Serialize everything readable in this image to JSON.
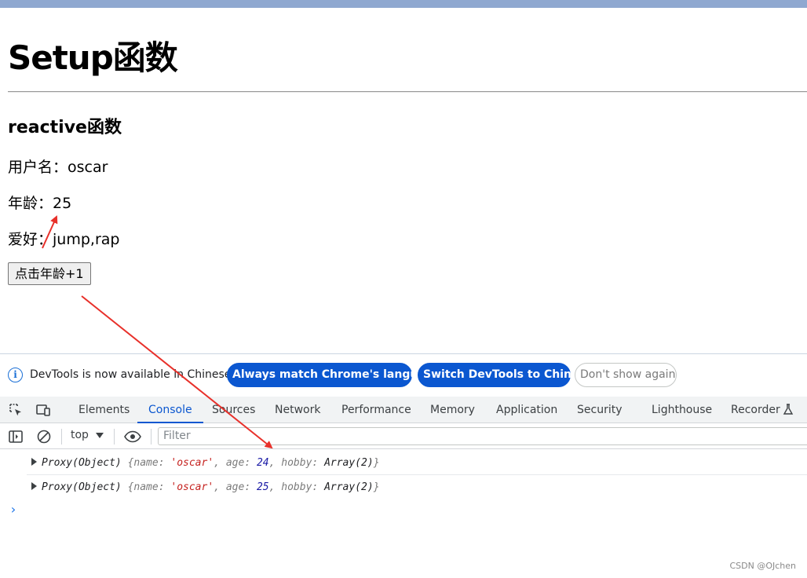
{
  "page": {
    "heading": "Setup函数",
    "subheading": "reactive函数",
    "username_label": "用户名：",
    "username_value": "oscar",
    "age_label": "年龄：",
    "age_value": "25",
    "hobby_label": "爱好：",
    "hobby_value": "jump,rap",
    "button_label": "点击年龄+1"
  },
  "devtools": {
    "info": {
      "text": "DevTools is now available in Chinese!",
      "match_language": "Always match Chrome's language",
      "switch_chinese": "Switch DevTools to Chinese",
      "dont_show": "Don't show again"
    },
    "tabs": [
      "Elements",
      "Console",
      "Sources",
      "Network",
      "Performance",
      "Memory",
      "Application",
      "Security",
      "Lighthouse",
      "Recorder"
    ],
    "active_tab": "Console",
    "console_toolbar": {
      "context": "top",
      "filter_placeholder": "Filter"
    },
    "logs": [
      {
        "prefix": "Proxy(Object)",
        "name_key": "name",
        "name_val": "'oscar'",
        "age_key": "age",
        "age_val": "24",
        "hobby_key": "hobby",
        "hobby_val": "Array(2)"
      },
      {
        "prefix": "Proxy(Object)",
        "name_key": "name",
        "name_val": "'oscar'",
        "age_key": "age",
        "age_val": "25",
        "hobby_key": "hobby",
        "hobby_val": "Array(2)"
      }
    ],
    "prompt": "›"
  },
  "watermark": "CSDN @OJchen",
  "colors": {
    "accent": "#0b57d0",
    "annotation_arrow": "#e8302a"
  },
  "icons": [
    "inspect-element-icon",
    "device-toolbar-icon",
    "info-icon",
    "sidebar-toggle-icon",
    "clear-console-icon",
    "eye-icon",
    "recorder-flask-icon",
    "expand-triangle-icon"
  ]
}
